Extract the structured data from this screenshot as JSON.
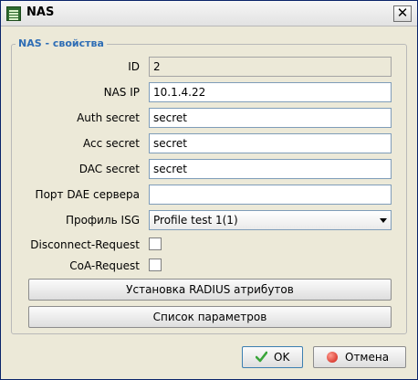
{
  "window": {
    "title": "NAS",
    "close_glyph": "✕"
  },
  "group": {
    "title": "NAS - свойства"
  },
  "fields": [
    {
      "label": "ID",
      "value": "2"
    },
    {
      "label": "NAS IP",
      "value": "10.1.4.22"
    },
    {
      "label": "Auth secret",
      "value": "secret"
    },
    {
      "label": "Acc secret",
      "value": "secret"
    },
    {
      "label": "DAC secret",
      "value": "secret"
    },
    {
      "label": "Порт DAE сервера",
      "value": ""
    }
  ],
  "isg_profile": {
    "label": "Профиль ISG",
    "selected": "Profile test 1(1)"
  },
  "checkboxes": [
    {
      "label": "Disconnect-Request",
      "checked": false
    },
    {
      "label": "CoA-Request",
      "checked": false
    }
  ],
  "buttons": {
    "radius_attrs": "Установка RADIUS атрибутов",
    "params_list": "Список параметров",
    "ok": "OK",
    "cancel": "Отмена"
  },
  "colors": {
    "accent": "#2e6db5",
    "ok_check": "#3aa53a",
    "cancel_icon": "#cc1b10"
  },
  "icons": {
    "app": "nas-app-icon",
    "ok": "check-icon",
    "cancel": "cancel-icon"
  }
}
